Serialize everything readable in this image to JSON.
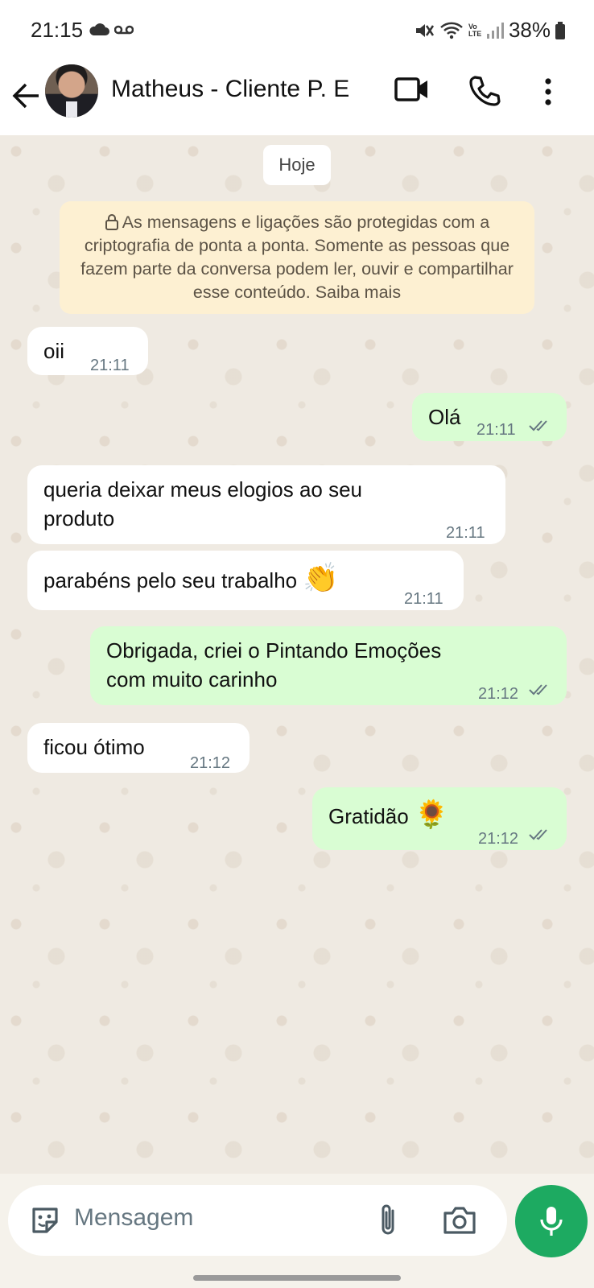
{
  "status_bar": {
    "time": "21:15",
    "battery": "38%",
    "icons": [
      "cloud-icon",
      "voicemail-icon",
      "mute-icon",
      "wifi-icon",
      "volte-icon",
      "signal-icon",
      "battery-icon"
    ],
    "volte_label": "Vo LTE"
  },
  "header": {
    "contact_name": "Matheus - Cliente P. E",
    "icons": [
      "back-arrow-icon",
      "video-call-icon",
      "voice-call-icon",
      "more-options-icon"
    ]
  },
  "chat": {
    "date_chip": "Hoje",
    "encryption_notice": "As mensagens e ligações são protegidas com a criptografia de ponta a ponta. Somente as pessoas que fazem parte da conversa podem ler, ouvir e compartilhar esse conteúdo. Saiba mais",
    "messages": [
      {
        "direction": "incoming",
        "text": "oii",
        "time": "21:11"
      },
      {
        "direction": "outgoing",
        "text": "Olá",
        "time": "21:11",
        "status": "read"
      },
      {
        "direction": "incoming",
        "text_line1": "queria deixar meus elogios ao seu",
        "text_line2": "produto",
        "time": "21:11"
      },
      {
        "direction": "incoming",
        "text": "parabéns pelo seu trabalho",
        "emoji": "👏",
        "time": "21:11"
      },
      {
        "direction": "outgoing",
        "text_line1": "Obrigada, criei o Pintando Emoções",
        "text_line2": "com muito carinho",
        "time": "21:12",
        "status": "read"
      },
      {
        "direction": "incoming",
        "text": "ficou ótimo",
        "time": "21:12"
      },
      {
        "direction": "outgoing",
        "text": "Gratidão",
        "emoji": "🌻",
        "time": "21:12",
        "status": "read"
      }
    ]
  },
  "composer": {
    "placeholder": "Mensagem",
    "icons": [
      "sticker-icon",
      "attach-icon",
      "camera-icon",
      "mic-icon"
    ]
  },
  "colors": {
    "incoming_bubble": "#ffffff",
    "outgoing_bubble": "#d9fdd3",
    "notice_bg": "#fdf0d2",
    "mic_button": "#1daa61",
    "read_ticks": "#53bdeb",
    "timestamp": "#667781"
  }
}
